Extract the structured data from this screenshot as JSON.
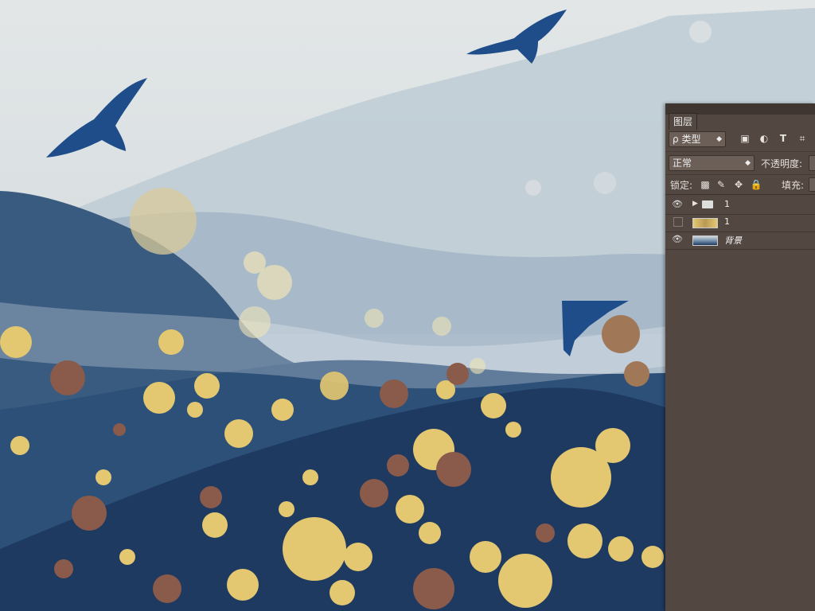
{
  "layers_panel": {
    "tab_label": "图层",
    "filter": {
      "placeholder": "类型",
      "search_glyph": "ρ"
    },
    "filter_icons": [
      "image-filter-icon",
      "adjustment-filter-icon",
      "type-filter-icon",
      "shape-filter-icon"
    ],
    "type_icon_glyph": "T",
    "blend_mode": "正常",
    "opacity_label": "不透明度:",
    "lock_label": "锁定:",
    "fill_label": "填充:",
    "layers": [
      {
        "name": "1",
        "type": "group",
        "visible": true
      },
      {
        "name": "1",
        "type": "pixel",
        "visible": false
      },
      {
        "name": "背景",
        "type": "background",
        "visible": true
      }
    ]
  },
  "colors": {
    "panel_bg": "#534741",
    "sky": "#dfe3e4",
    "mountain_dark": "#1f3d63",
    "mountain_mid": "#3d5f86",
    "gold": "#e3c871"
  }
}
